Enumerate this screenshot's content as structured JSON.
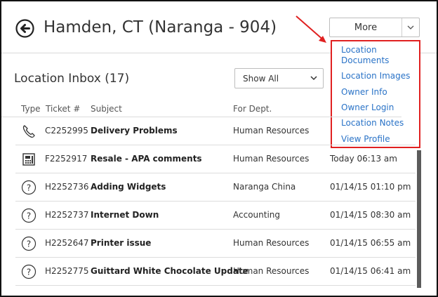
{
  "header": {
    "title": "Hamden, CT (Naranga - 904)",
    "back_icon": "back-arrow-icon"
  },
  "more_button": {
    "label": "More"
  },
  "more_menu": {
    "items": [
      "Location Documents",
      "Location Images",
      "Owner Info",
      "Owner Login",
      "Location Notes",
      "View Profile"
    ]
  },
  "inbox": {
    "title": "Location Inbox (17)",
    "filter": "Show All"
  },
  "table": {
    "columns": [
      "Type",
      "Ticket #",
      "Subject",
      "For Dept."
    ],
    "rows": [
      {
        "type_icon": "phone-icon",
        "ticket": "C2252995",
        "subject": "Delivery Problems",
        "dept": "Human Resources",
        "time": ""
      },
      {
        "type_icon": "fax-icon",
        "ticket": "F2252917",
        "subject": "Resale - APA comments",
        "dept": "Human Resources",
        "time": "Today 06:13 am"
      },
      {
        "type_icon": "question-icon",
        "ticket": "H2252736",
        "subject": "Adding Widgets",
        "dept": "Naranga China",
        "time": "01/14/15 01:10 pm"
      },
      {
        "type_icon": "question-icon",
        "ticket": "H2252737",
        "subject": "Internet Down",
        "dept": "Accounting",
        "time": "01/14/15 08:30 am"
      },
      {
        "type_icon": "question-icon",
        "ticket": "H2252647",
        "subject": "Printer issue",
        "dept": "Human Resources",
        "time": "01/14/15 06:55 am"
      },
      {
        "type_icon": "question-icon",
        "ticket": "H2252775",
        "subject": "Guittard White Chocolate Update",
        "dept": "Human Resources",
        "time": "01/14/15 06:41 am"
      }
    ]
  },
  "colors": {
    "accent_link": "#2a73c7",
    "highlight_border": "#e02020",
    "annotation_arrow": "#e02020"
  }
}
